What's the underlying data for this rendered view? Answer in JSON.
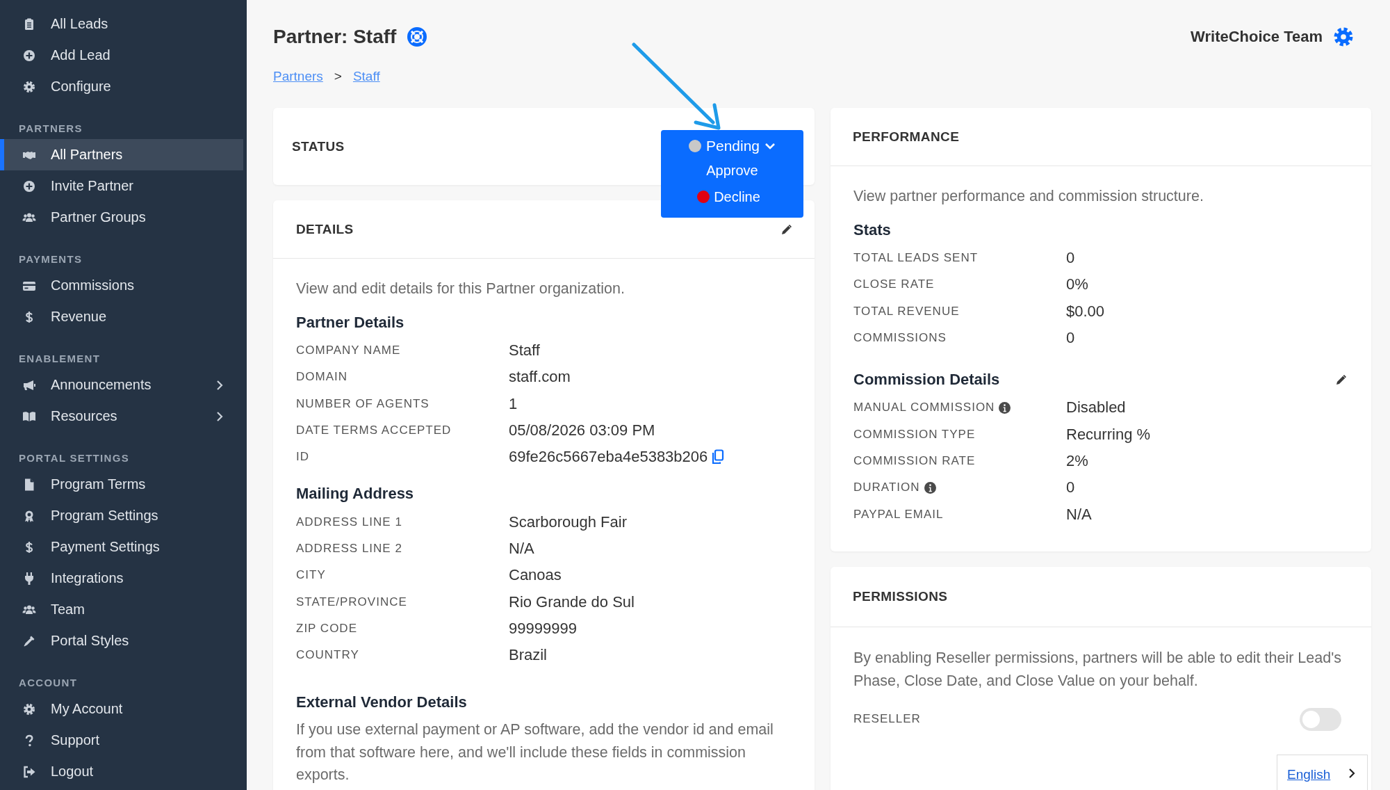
{
  "sidebar": {
    "sections": [
      {
        "items": [
          {
            "label": "All Leads",
            "selected": false,
            "expandable": false
          },
          {
            "label": "Add Lead",
            "selected": false,
            "expandable": false
          },
          {
            "label": "Configure",
            "selected": false,
            "expandable": false
          }
        ]
      },
      {
        "heading": "PARTNERS",
        "items": [
          {
            "label": "All Partners",
            "selected": true,
            "expandable": false
          },
          {
            "label": "Invite Partner",
            "selected": false,
            "expandable": false
          },
          {
            "label": "Partner Groups",
            "selected": false,
            "expandable": false
          }
        ]
      },
      {
        "heading": "PAYMENTS",
        "items": [
          {
            "label": "Commissions",
            "selected": false,
            "expandable": false
          },
          {
            "label": "Revenue",
            "selected": false,
            "expandable": false
          }
        ]
      },
      {
        "heading": "ENABLEMENT",
        "items": [
          {
            "label": "Announcements",
            "selected": false,
            "expandable": true
          },
          {
            "label": "Resources",
            "selected": false,
            "expandable": true
          }
        ]
      },
      {
        "heading": "PORTAL SETTINGS",
        "items": [
          {
            "label": "Program Terms",
            "selected": false,
            "expandable": false
          },
          {
            "label": "Program Settings",
            "selected": false,
            "expandable": false
          },
          {
            "label": "Payment Settings",
            "selected": false,
            "expandable": false
          },
          {
            "label": "Integrations",
            "selected": false,
            "expandable": false
          },
          {
            "label": "Team",
            "selected": false,
            "expandable": false
          },
          {
            "label": "Portal Styles",
            "selected": false,
            "expandable": false
          }
        ]
      },
      {
        "heading": "ACCOUNT",
        "items": [
          {
            "label": "My Account",
            "selected": false,
            "expandable": false
          },
          {
            "label": "Support",
            "selected": false,
            "expandable": false
          },
          {
            "label": "Logout",
            "selected": false,
            "expandable": false
          }
        ]
      }
    ]
  },
  "page": {
    "title": "Partner: Staff",
    "team": "WriteChoice Team",
    "breadcrumbs": [
      "Partners",
      "Staff"
    ],
    "breadcrumb_separator": ">"
  },
  "status": {
    "title": "STATUS",
    "dropdown": {
      "current": {
        "label": "Pending",
        "color": "#c8c8c8"
      },
      "options": [
        {
          "label": "Approve"
        },
        {
          "label": "Decline",
          "color": "#e00012"
        }
      ]
    }
  },
  "details": {
    "title": "DETAILS",
    "description": "View and edit details for this Partner organization.",
    "sections": [
      {
        "heading": "Partner Details",
        "rows": [
          {
            "label": "COMPANY NAME",
            "value": "Staff",
            "copyable": false
          },
          {
            "label": "DOMAIN",
            "value": "staff.com",
            "copyable": false
          },
          {
            "label": "NUMBER OF AGENTS",
            "value": "1",
            "copyable": false
          },
          {
            "label": "DATE TERMS ACCEPTED",
            "value": "05/08/2026 03:09 PM",
            "copyable": false
          },
          {
            "label": "ID",
            "value": "69fe26c5667eba4e5383b206",
            "copyable": true
          }
        ]
      },
      {
        "heading": "Mailing Address",
        "rows": [
          {
            "label": "ADDRESS LINE 1",
            "value": "Scarborough Fair"
          },
          {
            "label": "ADDRESS LINE 2",
            "value": "N/A"
          },
          {
            "label": "CITY",
            "value": "Canoas"
          },
          {
            "label": "STATE/PROVINCE",
            "value": "Rio Grande do Sul"
          },
          {
            "label": "ZIP CODE",
            "value": "99999999"
          },
          {
            "label": "COUNTRY",
            "value": "Brazil"
          }
        ]
      }
    ],
    "vendor": {
      "heading": "External Vendor Details",
      "text": "If you use external payment or AP software, add the vendor id and email from that software here, and we'll include these fields in commission exports."
    }
  },
  "performance": {
    "title": "PERFORMANCE",
    "description": "View partner performance and commission structure.",
    "stats": {
      "heading": "Stats",
      "rows": [
        {
          "label": "TOTAL LEADS SENT",
          "value": "0"
        },
        {
          "label": "CLOSE RATE",
          "value": "0%"
        },
        {
          "label": "TOTAL REVENUE",
          "value": "$0.00"
        },
        {
          "label": "COMMISSIONS",
          "value": "0"
        }
      ]
    },
    "commission": {
      "heading": "Commission Details",
      "rows": [
        {
          "label": "MANUAL COMMISSION",
          "value": "Disabled",
          "info": true
        },
        {
          "label": "COMMISSION TYPE",
          "value": "Recurring %",
          "info": false
        },
        {
          "label": "COMMISSION RATE",
          "value": "2%",
          "info": false
        },
        {
          "label": "DURATION",
          "value": "0",
          "info": true
        },
        {
          "label": "PAYPAL EMAIL",
          "value": "N/A",
          "info": false
        }
      ]
    }
  },
  "permissions": {
    "title": "PERMISSIONS",
    "description": "By enabling Reseller permissions, partners will be able to edit their Lead's Phase, Close Date, and Close Value on your behalf.",
    "toggle": {
      "label": "RESELLER",
      "on": false
    }
  },
  "language": {
    "label": "English"
  }
}
